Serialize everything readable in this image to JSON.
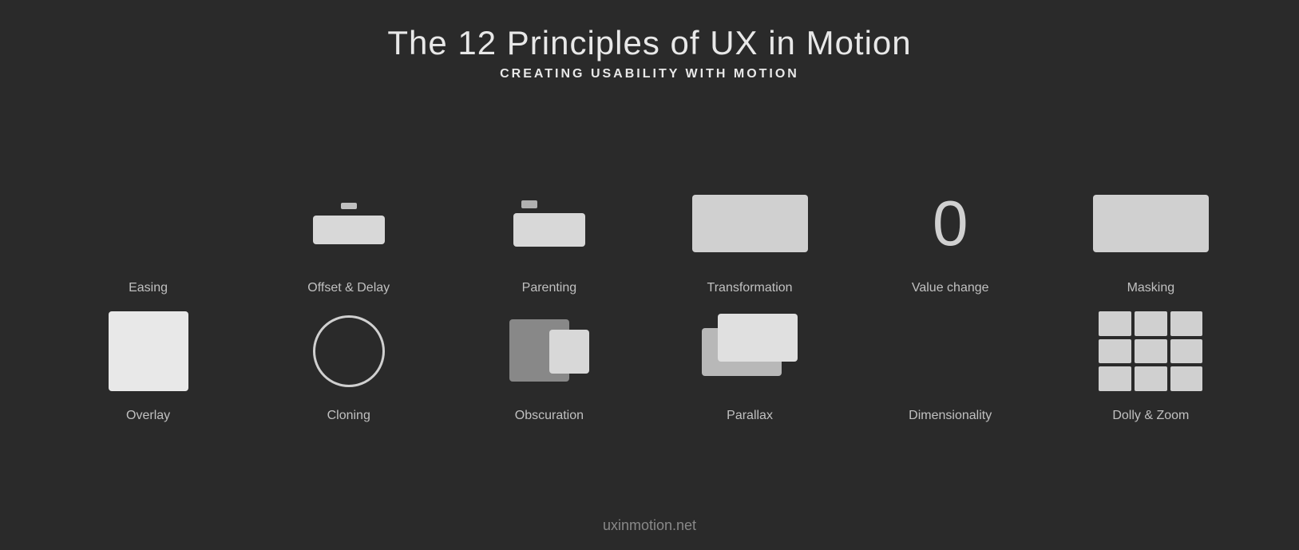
{
  "header": {
    "title": "The 12 Principles of UX in Motion",
    "subtitle": "CREATING USABILITY WITH MOTION"
  },
  "row1": {
    "items": [
      {
        "id": "easing",
        "label": "Easing"
      },
      {
        "id": "offset-delay",
        "label": "Offset & Delay"
      },
      {
        "id": "parenting",
        "label": "Parenting"
      },
      {
        "id": "transformation",
        "label": "Transformation"
      },
      {
        "id": "value-change",
        "label": "Value change",
        "value": "0"
      },
      {
        "id": "masking",
        "label": "Masking"
      }
    ]
  },
  "row2": {
    "items": [
      {
        "id": "overlay",
        "label": "Overlay"
      },
      {
        "id": "cloning",
        "label": "Cloning"
      },
      {
        "id": "obscuration",
        "label": "Obscuration"
      },
      {
        "id": "parallax",
        "label": "Parallax"
      },
      {
        "id": "dimensionality",
        "label": "Dimensionality"
      },
      {
        "id": "dolly-zoom",
        "label": "Dolly & Zoom"
      }
    ]
  },
  "footer": {
    "url": "uxinmotion.net"
  }
}
